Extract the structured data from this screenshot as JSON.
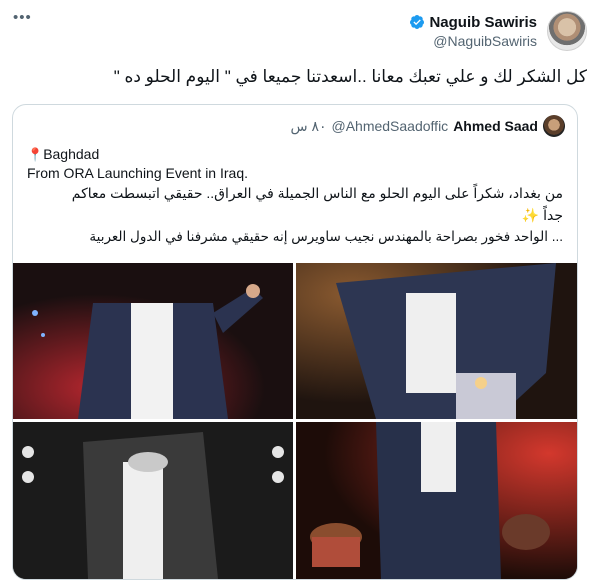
{
  "tweet": {
    "author": {
      "name": "Naguib Sawiris",
      "handle": "@NaguibSawiris",
      "verified": true
    },
    "text": "كل الشكر لك و علي تعبك معانا ..اسعدتنا جميعا في \" اليوم الحلو ده \"",
    "more_icon": "more-dots-icon",
    "verified_color": "#1d9bf0"
  },
  "quoted": {
    "author": {
      "name": "Ahmed Saad",
      "handle": "@AhmedSaadoffic",
      "time": "٨٠ س"
    },
    "place": "Baghdad",
    "place_icon": "pin-icon",
    "english": "From ORA Launching Event in Iraq.",
    "arabic_line1": "من بغداد، شكراً على اليوم الحلو مع الناس الجميلة في العراق.. حقيقي اتبسطت معاكم",
    "arabic_line2": "جداً ✨",
    "arabic_line3": "... الواحد فخور بصراحة بالمهندس نجيب ساويرس إنه حقيقي مشرفنا في الدول العربية",
    "photos": [
      "photo-1",
      "photo-2",
      "photo-3",
      "photo-4"
    ]
  }
}
